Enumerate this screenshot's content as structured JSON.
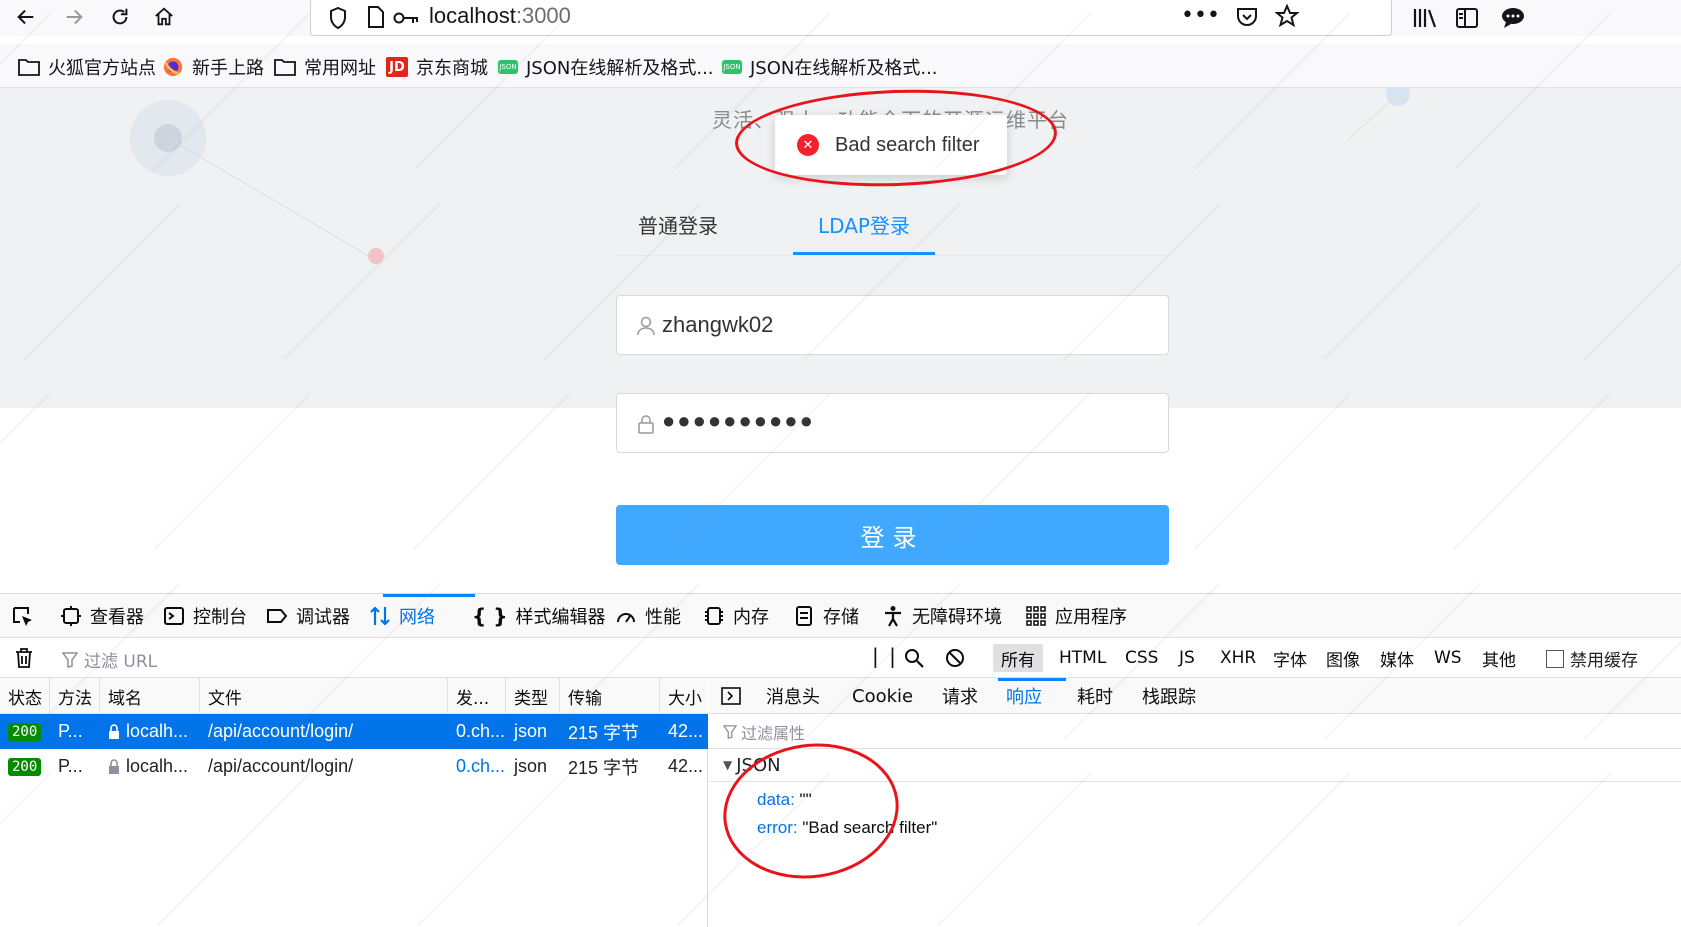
{
  "browser": {
    "url_host": "localhost",
    "url_port": ":3000"
  },
  "bookmarks": [
    {
      "label": "火狐官方站点",
      "icon": "folder-icon"
    },
    {
      "label": "新手上路",
      "icon": "firefox-icon"
    },
    {
      "label": "常用网址",
      "icon": "folder-icon"
    },
    {
      "label": "京东商城",
      "icon": "jd-icon"
    },
    {
      "label": "JSON在线解析及格式...",
      "icon": "json-icon"
    },
    {
      "label": "JSON在线解析及格式...",
      "icon": "json-icon"
    }
  ],
  "page": {
    "subtitle": "灵活、强大、功能全面的开源运维平台",
    "toast": {
      "message": "Bad search filter",
      "icon": "error-icon"
    },
    "tabs": {
      "normal": "普通登录",
      "ldap": "LDAP登录"
    },
    "username": "zhangwk02",
    "password": "●●●●●●●●●●",
    "login_button": "登录"
  },
  "devtools": {
    "tabs": [
      "查看器",
      "控制台",
      "调试器",
      "网络",
      "样式编辑器",
      "性能",
      "内存",
      "存储",
      "无障碍环境",
      "应用程序"
    ],
    "filter_placeholder": "过滤 URL",
    "filter_types": [
      "所有",
      "HTML",
      "CSS",
      "JS",
      "XHR",
      "字体",
      "图像",
      "媒体",
      "WS",
      "其他"
    ],
    "disable_cache": "禁用缓存",
    "columns": [
      "状态",
      "方法",
      "域名",
      "文件",
      "发...",
      "类型",
      "传输",
      "大小"
    ],
    "requests": [
      {
        "status": "200",
        "method": "P...",
        "domain": "localh...",
        "file": "/api/account/login/",
        "cause": "0.ch...",
        "type": "json",
        "transferred": "215 字节",
        "size": "42..."
      },
      {
        "status": "200",
        "method": "P...",
        "domain": "localh...",
        "file": "/api/account/login/",
        "cause": "0.ch...",
        "type": "json",
        "transferred": "215 字节",
        "size": "42..."
      }
    ],
    "detail_tabs": [
      "消息头",
      "Cookie",
      "请求",
      "响应",
      "耗时",
      "栈跟踪"
    ],
    "filter_props": "过滤属性",
    "json_label": "JSON",
    "json": {
      "data_key": "data:",
      "data_val": "\"\"",
      "error_key": "error:",
      "error_val": "\"Bad search filter\""
    }
  }
}
